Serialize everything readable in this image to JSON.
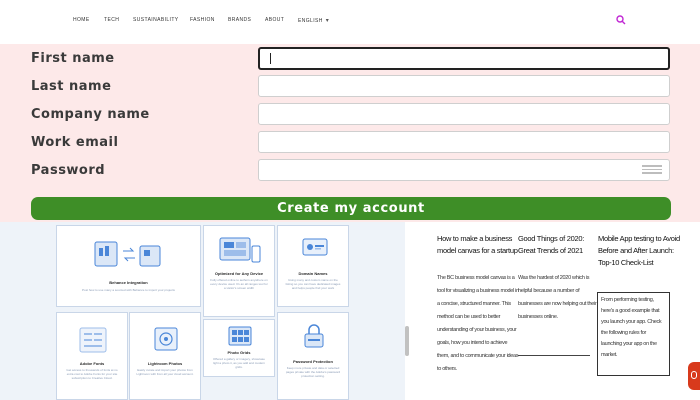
{
  "nav": {
    "items": [
      "HOME",
      "TECH",
      "SUSTAINABILITY",
      "FASHION",
      "BRANDS",
      "ABOUT",
      "ENGLISH"
    ],
    "chevron": "▾",
    "search_icon": "search-icon",
    "accent_color": "#c026d3"
  },
  "form": {
    "fields": [
      {
        "label": "First name",
        "value": ""
      },
      {
        "label": "Last name",
        "value": ""
      },
      {
        "label": "Company name",
        "value": ""
      },
      {
        "label": "Work email",
        "value": ""
      },
      {
        "label": "Password",
        "value": ""
      }
    ],
    "submit_label": "Create my account",
    "button_color": "#3e8e27",
    "background_color": "#fde9e9"
  },
  "features": {
    "cards": [
      {
        "title": "Behance Integration",
        "desc": "Post how to use many a sourced with Behance to import your projects",
        "icon": "behance-sync-icon"
      },
      {
        "title": "Optimized for Any Device",
        "desc": "Fully offered online to authors anywhere on every device used. It's an all ranges tool for a visitor's screen width",
        "icon": "devices-icon"
      },
      {
        "title": "Domain Names",
        "desc": "Using many and custom name on the listing so you can have dedicated images and helps people find your work",
        "icon": "domain-icon"
      },
      {
        "title": "Adobe Fonts",
        "desc": "Get access to thousands of fonts at no extra cost to Adobe Fonts for your site subscription to Creative Cloud.",
        "icon": "fonts-icon"
      },
      {
        "title": "Lightroom Photos",
        "desc": "Easily curate and import your photos from Lightroom with from all your cloud account.",
        "icon": "lightroom-icon"
      },
      {
        "title": "Photo Grids",
        "desc": "Offered a gallery or imagery, showcase light a photo it, as you add and modern grids.",
        "icon": "grid-icon"
      },
      {
        "title": "Password Protection",
        "desc": "Keep more private and data or selected pages private with the Adobe's password protection setting.",
        "icon": "lock-icon"
      }
    ]
  },
  "articles": [
    {
      "title": "How to make a business model canvas for a startup",
      "body": "The BC business model canvas is a tool for visualizing a business model in a concise, structured manner. This method can be used to better understanding of your business, your goals, how you intend to achieve them, and to communicate your ideas to others."
    },
    {
      "title": "Good Things of 2020: Great Trends of 2021",
      "body": "Was the hardest of 2020 which is helpful because a number of businesses are now helping out their businesses online."
    },
    {
      "title": "Mobile App testing to Avoid Before and After Launch: Top-10 Check-List",
      "body": "From performing testing, here's a good example that you launch your app. Check the following rules for launching your app on the market."
    }
  ]
}
